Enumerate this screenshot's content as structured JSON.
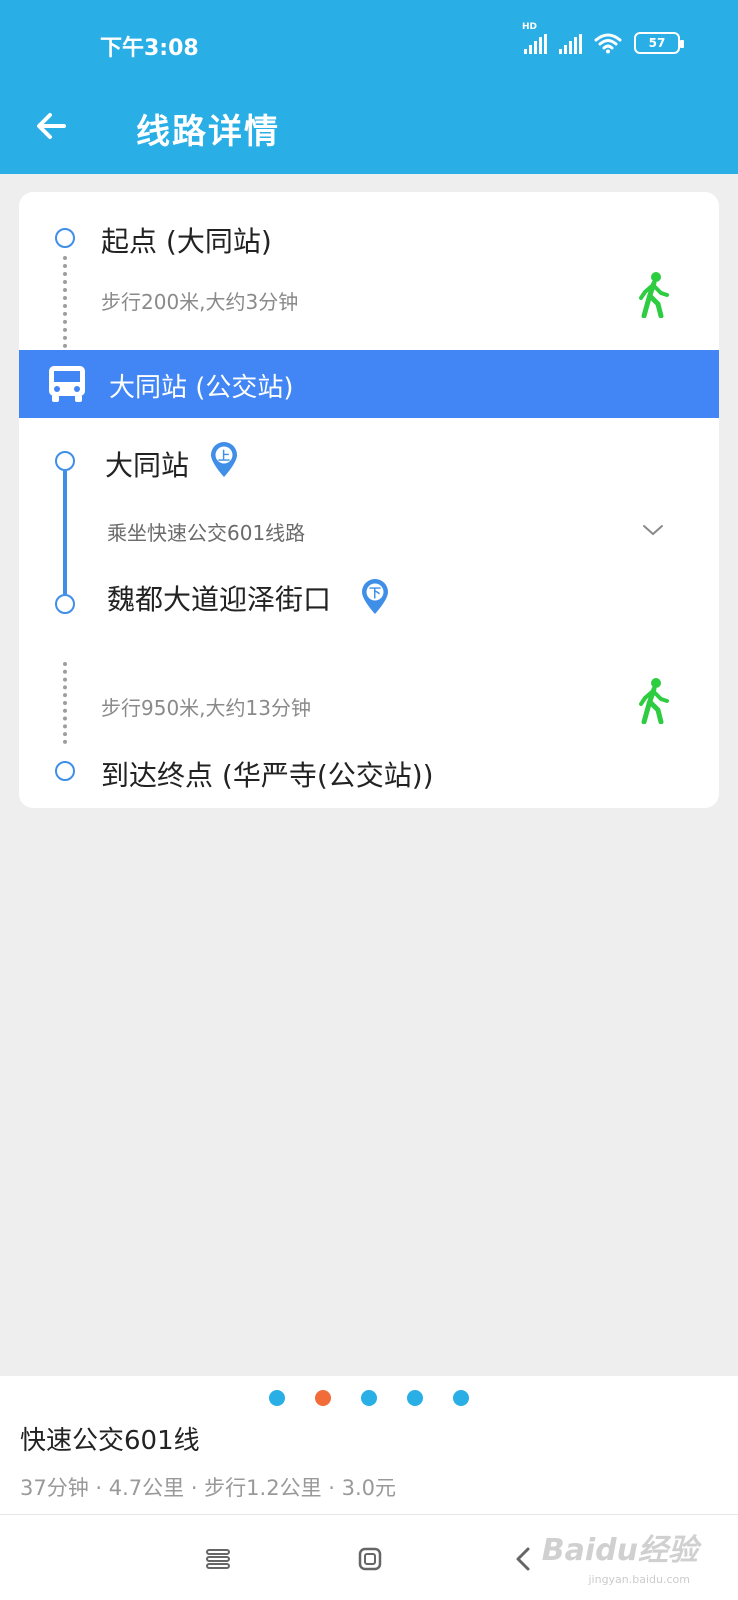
{
  "status_bar": {
    "time": "下午3:08",
    "network": "HD",
    "battery": "57",
    "icons": [
      "hd-signal-icon",
      "signal-icon",
      "wifi-icon",
      "battery-icon"
    ]
  },
  "app_bar": {
    "title": "线路详情",
    "back_icon": "arrow-left-icon",
    "color": "#29aee6"
  },
  "route_detail": {
    "start": "起点 (大同站)",
    "walk_1": "步行200米,大约3分钟",
    "bus_stop_header": "大同站 (公交站)",
    "board_stop": "大同站",
    "board_badge": "上",
    "ride_info": "乘坐快速公交601线路",
    "alight_stop": "魏都大道迎泽街口",
    "alight_badge": "下",
    "walk_2": "步行950米,大约13分钟",
    "end": "到达终点 (华严寺(公交站))",
    "accent_color": "#4285f4",
    "walk_color": "#2ecc40"
  },
  "plan_summary": {
    "pager": {
      "count": 5,
      "active_index": 1
    },
    "route_name": "快速公交601线",
    "meta": "37分钟 · 4.7公里 · 步行1.2公里 · 3.0元"
  },
  "nav_bar": {
    "buttons": [
      "menu-icon",
      "home-icon",
      "back-icon"
    ],
    "watermark": "Baidu经验",
    "watermark_url": "jingyan.baidu.com"
  }
}
